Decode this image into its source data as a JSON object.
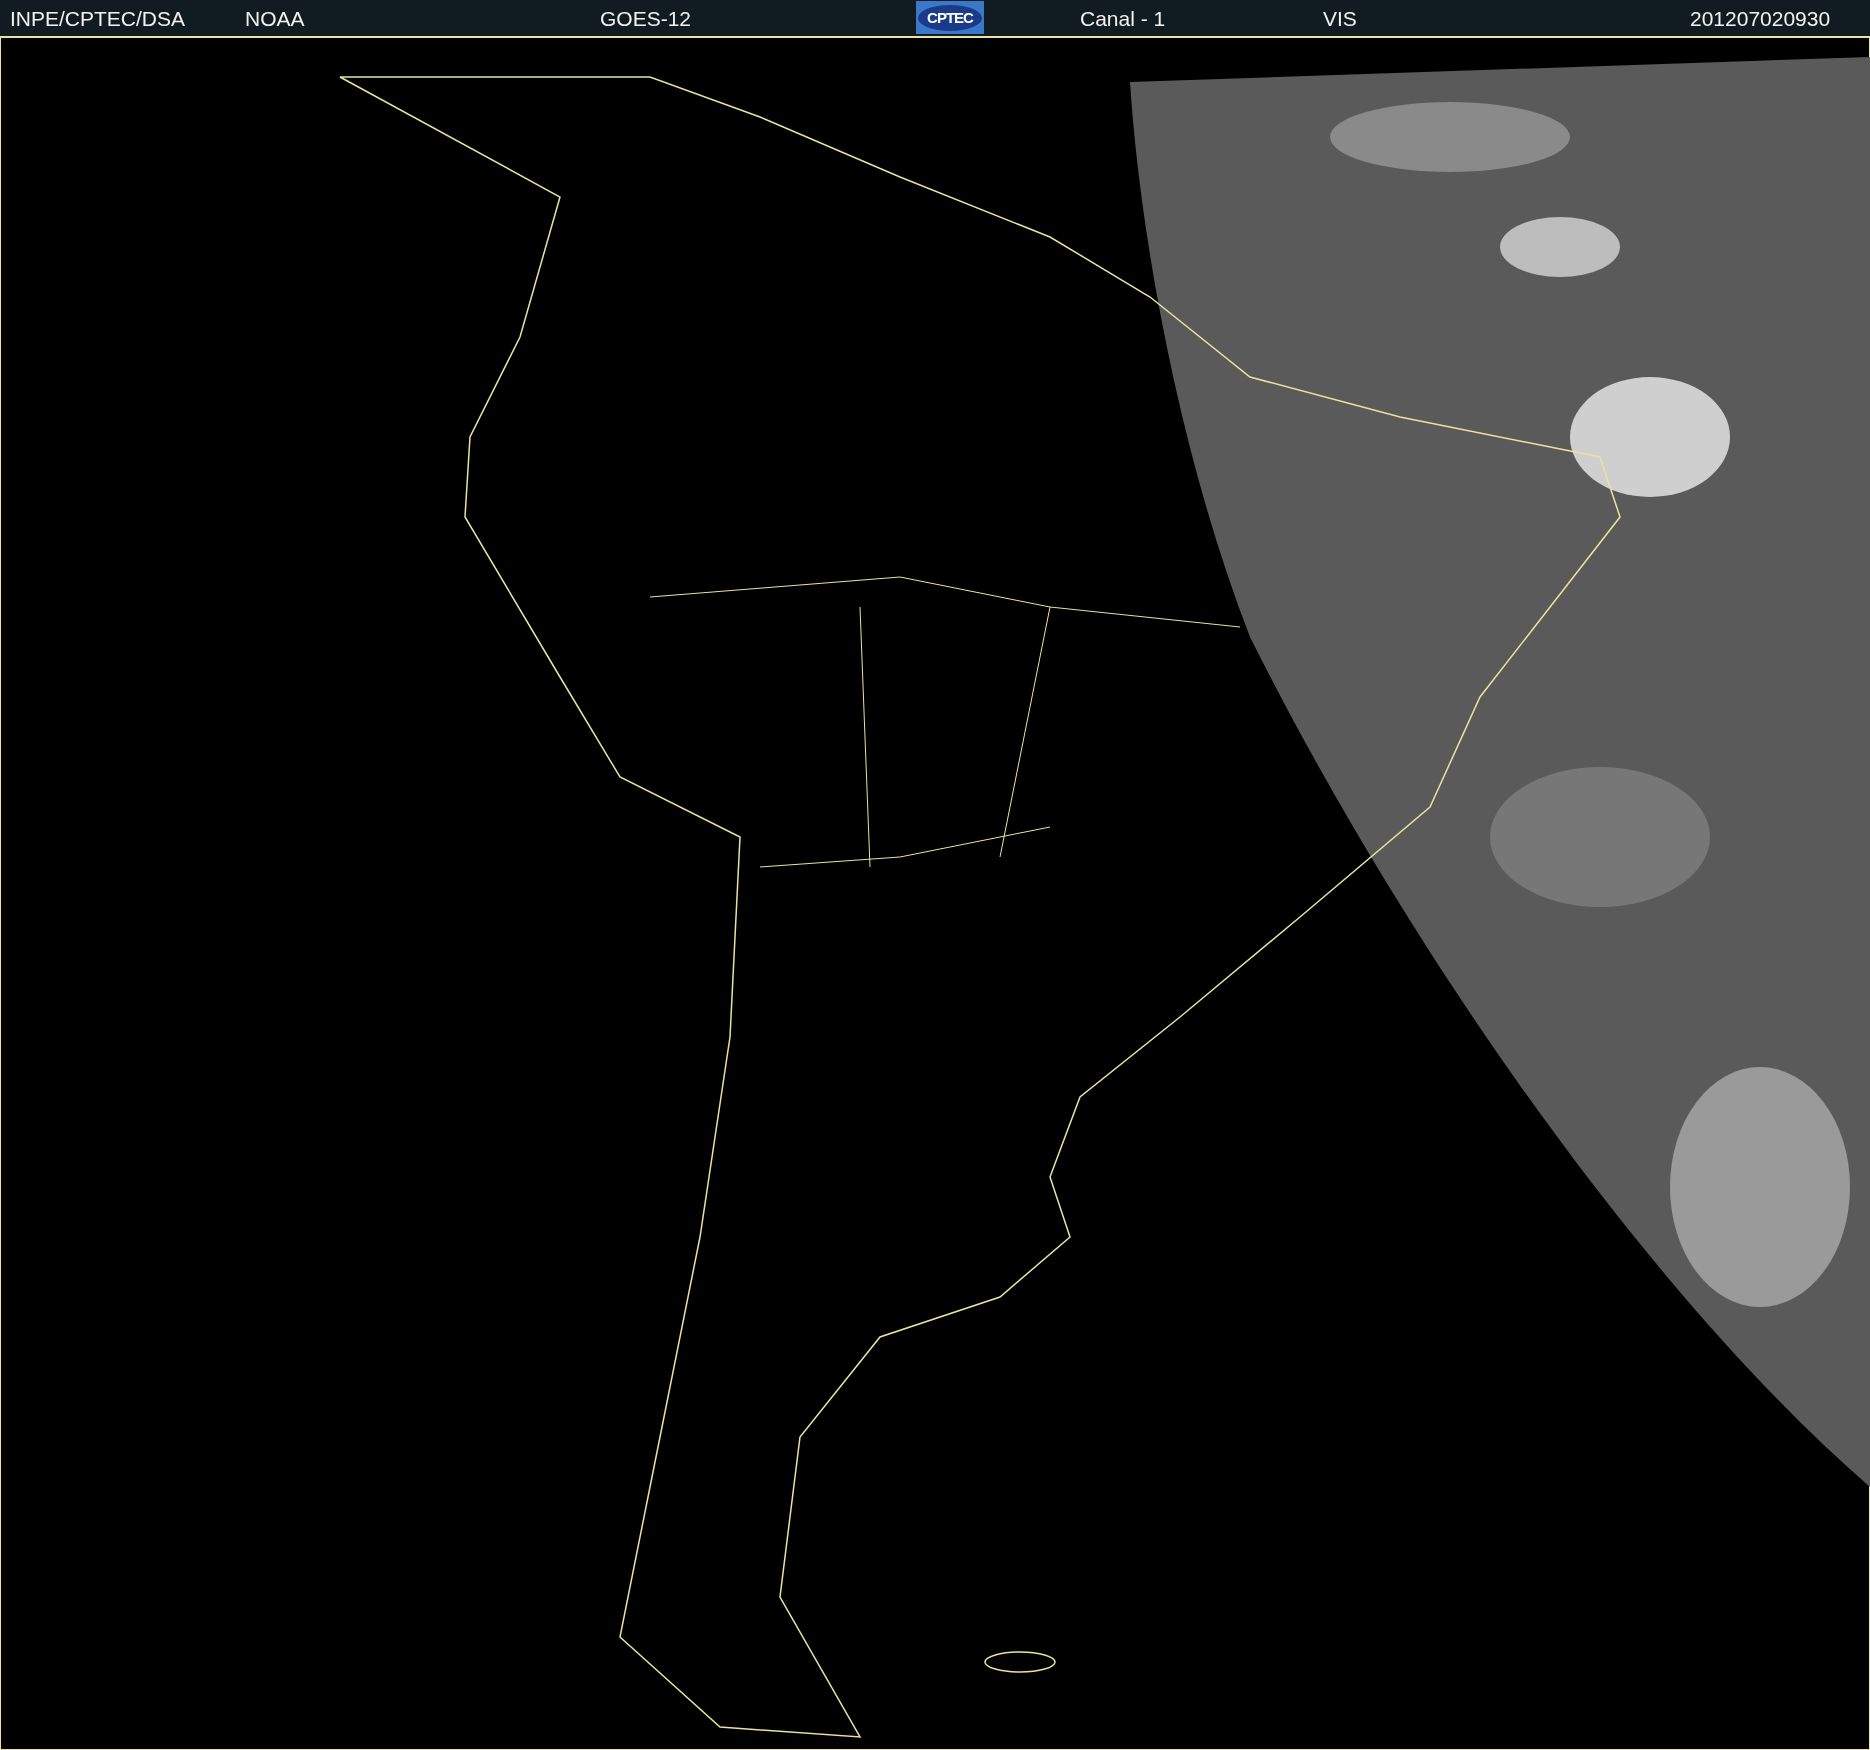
{
  "header": {
    "items": [
      {
        "kind": "text",
        "text": "INPE/CPTEC/DSA"
      },
      {
        "kind": "text",
        "text": "NOAA"
      },
      {
        "kind": "text",
        "text": "GOES-12"
      },
      {
        "kind": "logo",
        "text": "CPTEC"
      },
      {
        "kind": "text",
        "text": "Canal - 1"
      },
      {
        "kind": "text",
        "text": "VIS"
      },
      {
        "kind": "text",
        "text": "201207020930"
      }
    ]
  }
}
